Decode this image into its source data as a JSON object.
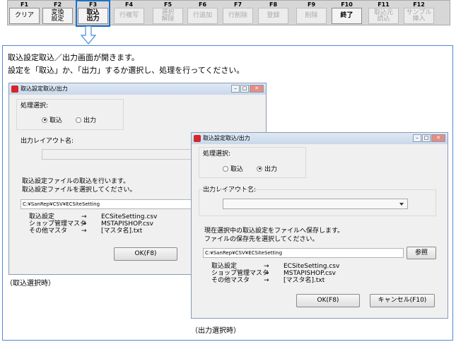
{
  "fkeys": [
    {
      "num": "F1",
      "label": "クリア",
      "state": "normal"
    },
    {
      "num": "F2",
      "label": "変換\n設定",
      "state": "normal"
    },
    {
      "num": "F3",
      "label": "取込\n出力",
      "state": "active"
    },
    {
      "num": "F4",
      "label": "行複写",
      "state": "disabled"
    },
    {
      "num": "F5",
      "label": "選択\n解除",
      "state": "disabled"
    },
    {
      "num": "F6",
      "label": "行追加",
      "state": "disabled"
    },
    {
      "num": "F7",
      "label": "行削除",
      "state": "disabled"
    },
    {
      "num": "F8",
      "label": "登録",
      "state": "disabled"
    },
    {
      "num": "F9",
      "label": "削除",
      "state": "disabled"
    },
    {
      "num": "F10",
      "label": "終了",
      "state": "active"
    },
    {
      "num": "F11",
      "label": "取込元\n読込",
      "state": "disabled"
    },
    {
      "num": "F12",
      "label": "サンプル\n挿入",
      "state": "disabled"
    }
  ],
  "description": {
    "line1": "取込設定取込／出力画面が開きます。",
    "line2": "設定を「取込」か、「出力」するか選択し、処理を行ってください。"
  },
  "dialog_import": {
    "title": "取込設定取込/出力",
    "process_label": "処理選択:",
    "radio_import": "取込",
    "radio_export": "出力",
    "selected": "import",
    "layout_label": "出力レイアウト名:",
    "info_line1": "取込設定ファイルの取込を行います。",
    "info_line2": "取込設定ファイルを選択してください。",
    "path": "C:¥SanRep¥CSV¥ECSiteSetting",
    "mappings": [
      {
        "key": "取込設定",
        "arrow": "→",
        "value": "ECSiteSetting.csv"
      },
      {
        "key": "ショップ管理マスタ",
        "arrow": "→",
        "value": "MSTAPISHOP.csv"
      },
      {
        "key": "その他マスタ",
        "arrow": "→",
        "value": "[マスタ名].txt"
      }
    ],
    "ok_label": "OK(F8)",
    "caption": "（取込選択時）"
  },
  "dialog_export": {
    "title": "取込設定取込/出力",
    "process_label": "処理選択:",
    "radio_import": "取込",
    "radio_export": "出力",
    "selected": "export",
    "layout_label": "出力レイアウト名:",
    "info_line1": "現在選択中の取込設定をファイルへ保存します。",
    "info_line2": "ファイルの保存先を選択してください。",
    "path": "C:¥SanRep¥CSV¥ECSiteSetting",
    "browse_label": "参照",
    "mappings": [
      {
        "key": "取込設定",
        "arrow": "→",
        "value": "ECSiteSetting.csv"
      },
      {
        "key": "ショップ管理マスタ",
        "arrow": "→",
        "value": "MSTAPISHOP.csv"
      },
      {
        "key": "その他マスタ",
        "arrow": "→",
        "value": "[マスタ名].txt"
      }
    ],
    "ok_label": "OK(F8)",
    "cancel_label": "キャンセル(F10)",
    "caption": "（出力選択時）"
  },
  "colors": {
    "accent": "#1a73c8",
    "frame": "#4a8bd6"
  }
}
